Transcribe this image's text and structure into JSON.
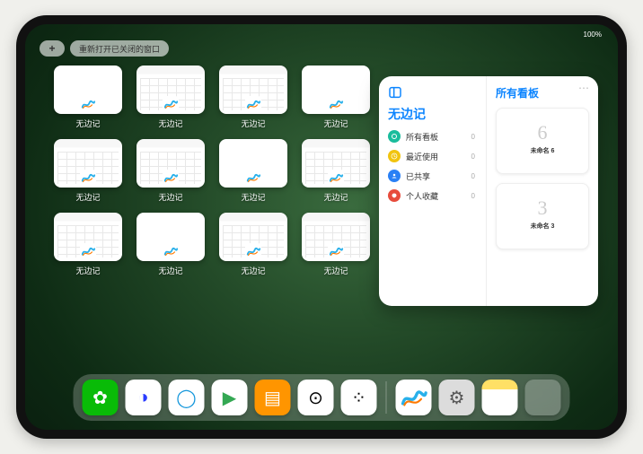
{
  "status": {
    "time": "",
    "battery": "100%"
  },
  "toolbar": {
    "plus_label": "+",
    "reopen_label": "重新打开已关闭的窗口"
  },
  "app_icon_emoji": "📊",
  "thumbs": [
    {
      "label": "无边记",
      "style": "blank"
    },
    {
      "label": "无边记",
      "style": "grid"
    },
    {
      "label": "无边记",
      "style": "grid"
    },
    {
      "label": "无边记",
      "style": "blank"
    },
    {
      "label": "无边记",
      "style": "grid"
    },
    {
      "label": "无边记",
      "style": "grid"
    },
    {
      "label": "无边记",
      "style": "blank"
    },
    {
      "label": "无边记",
      "style": "grid"
    },
    {
      "label": "无边记",
      "style": "grid"
    },
    {
      "label": "无边记",
      "style": "blank"
    },
    {
      "label": "无边记",
      "style": "grid"
    },
    {
      "label": "无边记",
      "style": "grid"
    }
  ],
  "panel": {
    "left_title": "无边记",
    "right_title": "所有看板",
    "nav": [
      {
        "label": "所有看板",
        "count": "0",
        "color": "#1abc9c"
      },
      {
        "label": "最近使用",
        "count": "0",
        "color": "#f1c40f"
      },
      {
        "label": "已共享",
        "count": "0",
        "color": "#2980f5"
      },
      {
        "label": "个人收藏",
        "count": "0",
        "color": "#e74c3c"
      }
    ],
    "boards": [
      {
        "glyph": "6",
        "name": "未命名 6",
        "sub": ""
      },
      {
        "glyph": "3",
        "name": "未命名 3",
        "sub": ""
      }
    ]
  },
  "dock": {
    "apps": [
      {
        "name": "wechat",
        "bg": "#09bb07",
        "glyph": "✿",
        "fg": "#fff"
      },
      {
        "name": "quark",
        "bg": "#ffffff",
        "glyph": "◑",
        "fg": "#2a3cff"
      },
      {
        "name": "qqbrowser",
        "bg": "#ffffff",
        "glyph": "◯",
        "fg": "#1296db"
      },
      {
        "name": "play",
        "bg": "#ffffff",
        "glyph": "▶",
        "fg": "#34a853"
      },
      {
        "name": "books",
        "bg": "#ff9500",
        "glyph": "▤",
        "fg": "#fff"
      },
      {
        "name": "dice",
        "bg": "#ffffff",
        "glyph": "⊙",
        "fg": "#000"
      },
      {
        "name": "molecules",
        "bg": "#ffffff",
        "glyph": "⁘",
        "fg": "#000"
      }
    ],
    "recent": [
      {
        "name": "freeform",
        "bg": "#ffffff"
      },
      {
        "name": "settings",
        "bg": "#dcdcdc",
        "glyph": "⚙",
        "fg": "#555"
      },
      {
        "name": "notes",
        "bg": "linear-gradient(#ffe066 28%,#fff 28%)",
        "glyph": "",
        "fg": "#000"
      }
    ],
    "library_mini": [
      "#84d36b",
      "#1296db",
      "#f7c948",
      "#0a84ff"
    ]
  }
}
